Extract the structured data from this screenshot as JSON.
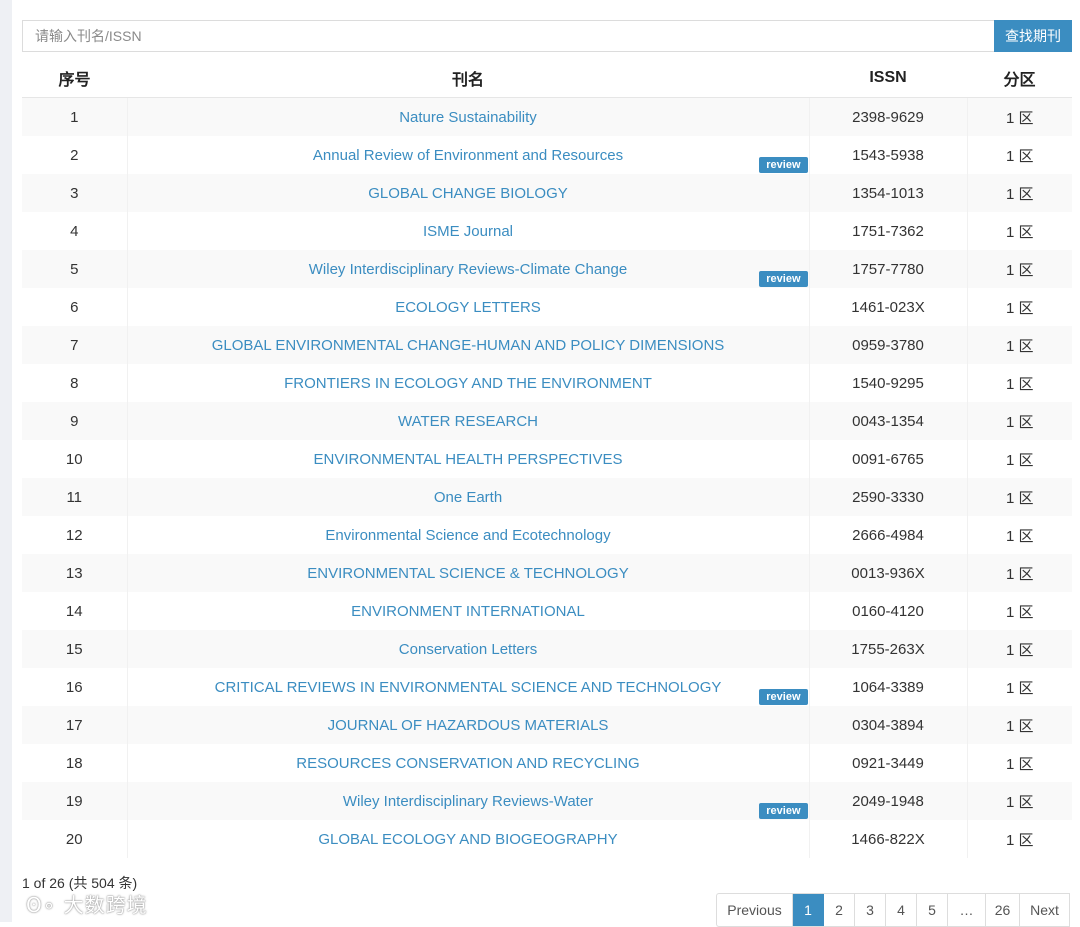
{
  "search": {
    "placeholder": "请输入刊名/ISSN",
    "value": "",
    "button_label": "查找期刊"
  },
  "table": {
    "headers": {
      "index": "序号",
      "name": "刊名",
      "issn": "ISSN",
      "zone": "分区"
    },
    "review_label": "review",
    "rows": [
      {
        "index": "1",
        "name": "Nature Sustainability",
        "issn": "2398-9629",
        "zone": "1 区",
        "review": false
      },
      {
        "index": "2",
        "name": "Annual Review of Environment and Resources",
        "issn": "1543-5938",
        "zone": "1 区",
        "review": true
      },
      {
        "index": "3",
        "name": "GLOBAL CHANGE BIOLOGY",
        "issn": "1354-1013",
        "zone": "1 区",
        "review": false
      },
      {
        "index": "4",
        "name": "ISME Journal",
        "issn": "1751-7362",
        "zone": "1 区",
        "review": false
      },
      {
        "index": "5",
        "name": "Wiley Interdisciplinary Reviews-Climate Change",
        "issn": "1757-7780",
        "zone": "1 区",
        "review": true
      },
      {
        "index": "6",
        "name": "ECOLOGY LETTERS",
        "issn": "1461-023X",
        "zone": "1 区",
        "review": false
      },
      {
        "index": "7",
        "name": "GLOBAL ENVIRONMENTAL CHANGE-HUMAN AND POLICY DIMENSIONS",
        "issn": "0959-3780",
        "zone": "1 区",
        "review": false
      },
      {
        "index": "8",
        "name": "FRONTIERS IN ECOLOGY AND THE ENVIRONMENT",
        "issn": "1540-9295",
        "zone": "1 区",
        "review": false
      },
      {
        "index": "9",
        "name": "WATER RESEARCH",
        "issn": "0043-1354",
        "zone": "1 区",
        "review": false
      },
      {
        "index": "10",
        "name": "ENVIRONMENTAL HEALTH PERSPECTIVES",
        "issn": "0091-6765",
        "zone": "1 区",
        "review": false
      },
      {
        "index": "11",
        "name": "One Earth",
        "issn": "2590-3330",
        "zone": "1 区",
        "review": false
      },
      {
        "index": "12",
        "name": "Environmental Science and Ecotechnology",
        "issn": "2666-4984",
        "zone": "1 区",
        "review": false
      },
      {
        "index": "13",
        "name": "ENVIRONMENTAL SCIENCE & TECHNOLOGY",
        "issn": "0013-936X",
        "zone": "1 区",
        "review": false
      },
      {
        "index": "14",
        "name": "ENVIRONMENT INTERNATIONAL",
        "issn": "0160-4120",
        "zone": "1 区",
        "review": false
      },
      {
        "index": "15",
        "name": "Conservation Letters",
        "issn": "1755-263X",
        "zone": "1 区",
        "review": false
      },
      {
        "index": "16",
        "name": "CRITICAL REVIEWS IN ENVIRONMENTAL SCIENCE AND TECHNOLOGY",
        "issn": "1064-3389",
        "zone": "1 区",
        "review": true
      },
      {
        "index": "17",
        "name": "JOURNAL OF HAZARDOUS MATERIALS",
        "issn": "0304-3894",
        "zone": "1 区",
        "review": false
      },
      {
        "index": "18",
        "name": "RESOURCES CONSERVATION AND RECYCLING",
        "issn": "0921-3449",
        "zone": "1 区",
        "review": false
      },
      {
        "index": "19",
        "name": "Wiley Interdisciplinary Reviews-Water",
        "issn": "2049-1948",
        "zone": "1 区",
        "review": true
      },
      {
        "index": "20",
        "name": "GLOBAL ECOLOGY AND BIOGEOGRAPHY",
        "issn": "1466-822X",
        "zone": "1 区",
        "review": false
      }
    ]
  },
  "pagination": {
    "info": "1 of 26 (共 504 条)",
    "previous": "Previous",
    "next": "Next",
    "pages": [
      "1",
      "2",
      "3",
      "4",
      "5",
      "…",
      "26"
    ],
    "current": "1"
  },
  "watermark": "大数跨境",
  "colors": {
    "accent": "#3b8dc1",
    "stripe": "#f9f9f9"
  }
}
